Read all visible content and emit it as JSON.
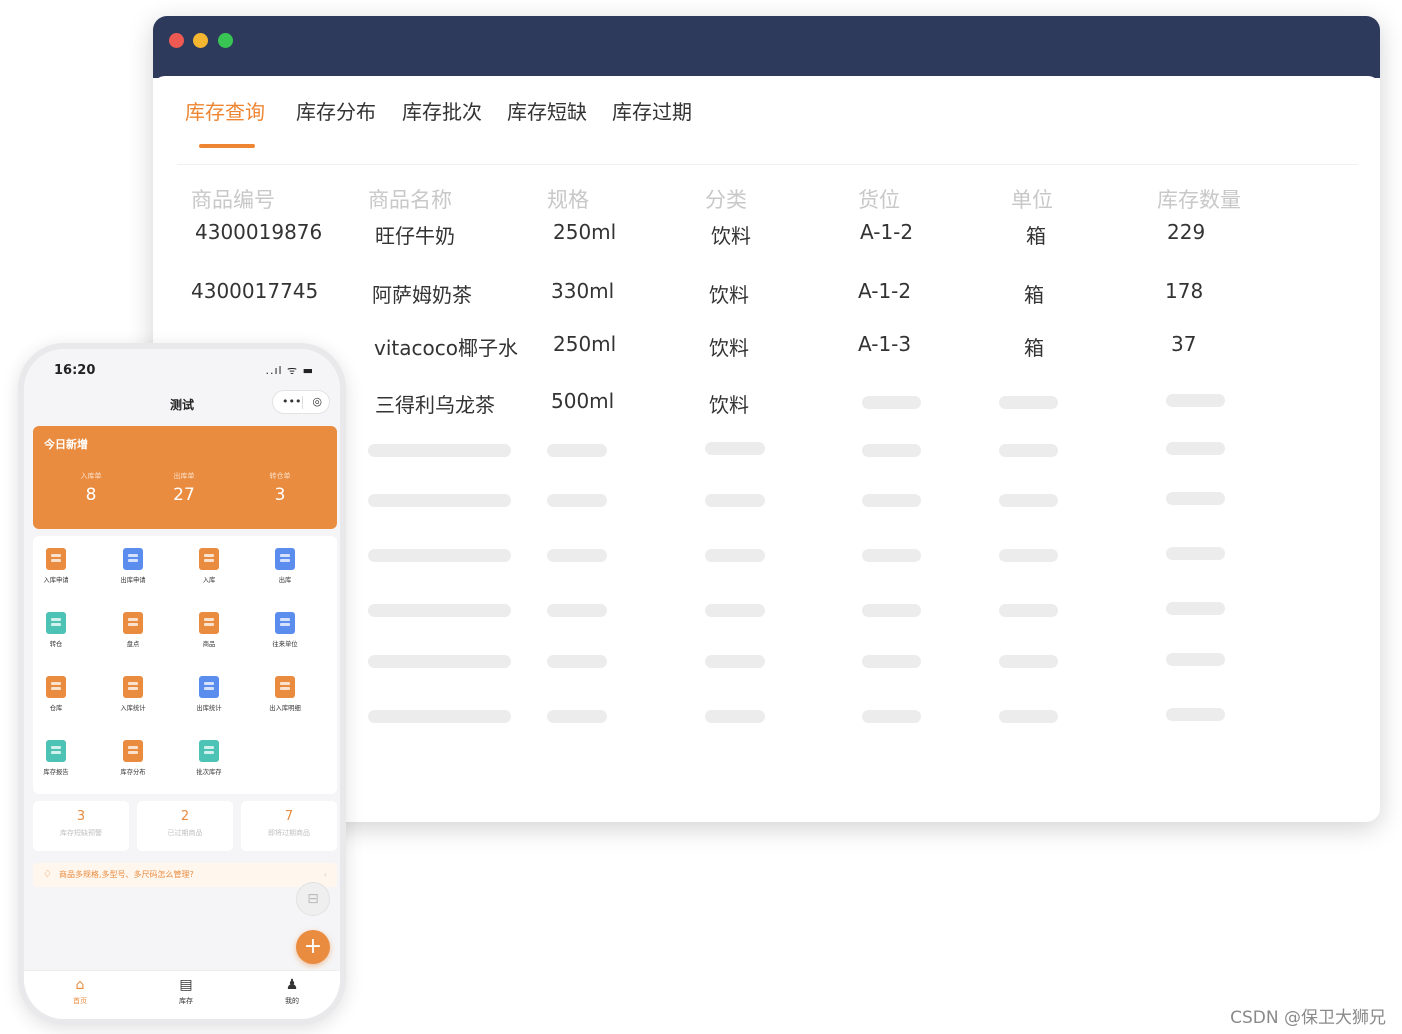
{
  "colors": {
    "accent": "#ee8532",
    "titlebar": "#2d3a5c",
    "phone_accent": "#e98c3f"
  },
  "desktop": {
    "tabs": [
      "库存查询",
      "库存分布",
      "库存批次",
      "库存短缺",
      "库存过期"
    ],
    "columns": [
      "商品编号",
      "商品名称",
      "规格",
      "分类",
      "货位",
      "单位",
      "库存数量"
    ],
    "rows": [
      [
        "4300019876",
        "旺仔牛奶",
        "250ml",
        "饮料",
        "A-1-2",
        "箱",
        "229"
      ],
      [
        "4300017745",
        "阿萨姆奶茶",
        "330ml",
        "饮料",
        "A-1-2",
        "箱",
        "178"
      ],
      [
        "",
        "vitacoco椰子水",
        "250ml",
        "饮料",
        "A-1-3",
        "箱",
        "37"
      ],
      [
        "",
        "三得利乌龙茶",
        "500ml",
        "饮料",
        "",
        "",
        ""
      ]
    ]
  },
  "phone": {
    "time": "16:20",
    "status_icons": "..ıl ᯤ ▬",
    "title": "测试",
    "capsule_more": "•••",
    "capsule_close": "◎",
    "today": {
      "title": "今日新增",
      "stats": [
        {
          "label": "入库单",
          "value": "8"
        },
        {
          "label": "出库单",
          "value": "27"
        },
        {
          "label": "转仓单",
          "value": "3"
        }
      ]
    },
    "grid": [
      {
        "label": "入库申请",
        "icon": "inbound-apply-icon",
        "color": "#e98c3f"
      },
      {
        "label": "出库申请",
        "icon": "outbound-apply-icon",
        "color": "#5b8def"
      },
      {
        "label": "入库",
        "icon": "inbound-icon",
        "color": "#e98c3f"
      },
      {
        "label": "出库",
        "icon": "outbound-icon",
        "color": "#5b8def"
      },
      {
        "label": "转仓",
        "icon": "transfer-icon",
        "color": "#4cc3b5"
      },
      {
        "label": "盘点",
        "icon": "stocktake-icon",
        "color": "#e98c3f"
      },
      {
        "label": "商品",
        "icon": "product-icon",
        "color": "#e98c3f"
      },
      {
        "label": "往来单位",
        "icon": "partner-icon",
        "color": "#5b8def"
      },
      {
        "label": "仓库",
        "icon": "warehouse-icon",
        "color": "#e98c3f"
      },
      {
        "label": "入库统计",
        "icon": "inbound-stats-icon",
        "color": "#e98c3f"
      },
      {
        "label": "出库统计",
        "icon": "outbound-stats-icon",
        "color": "#5b8def"
      },
      {
        "label": "出入库明细",
        "icon": "detail-icon",
        "color": "#e98c3f"
      },
      {
        "label": "库存报告",
        "icon": "stock-report-icon",
        "color": "#4cc3b5"
      },
      {
        "label": "库存分布",
        "icon": "stock-distribution-icon",
        "color": "#e98c3f"
      },
      {
        "label": "批次库存",
        "icon": "batch-stock-icon",
        "color": "#4cc3b5"
      }
    ],
    "mini_stats": [
      {
        "value": "3",
        "label": "库存短缺预警"
      },
      {
        "value": "2",
        "label": "已过期商品"
      },
      {
        "value": "7",
        "label": "即将过期商品"
      }
    ],
    "notice": {
      "icon": "bell-icon",
      "text": "商品多规格,多型号、多尺码怎么管理?",
      "arrow": "›"
    },
    "scan_glyph": "⊟",
    "add_glyph": "+",
    "tabbar": [
      {
        "label": "首页",
        "icon": "home-icon",
        "glyph": "⌂",
        "active": true
      },
      {
        "label": "库存",
        "icon": "inventory-icon",
        "glyph": "▤",
        "active": false
      },
      {
        "label": "我的",
        "icon": "user-icon",
        "glyph": "♟",
        "active": false
      }
    ]
  },
  "watermark": "CSDN @保卫大狮兄"
}
